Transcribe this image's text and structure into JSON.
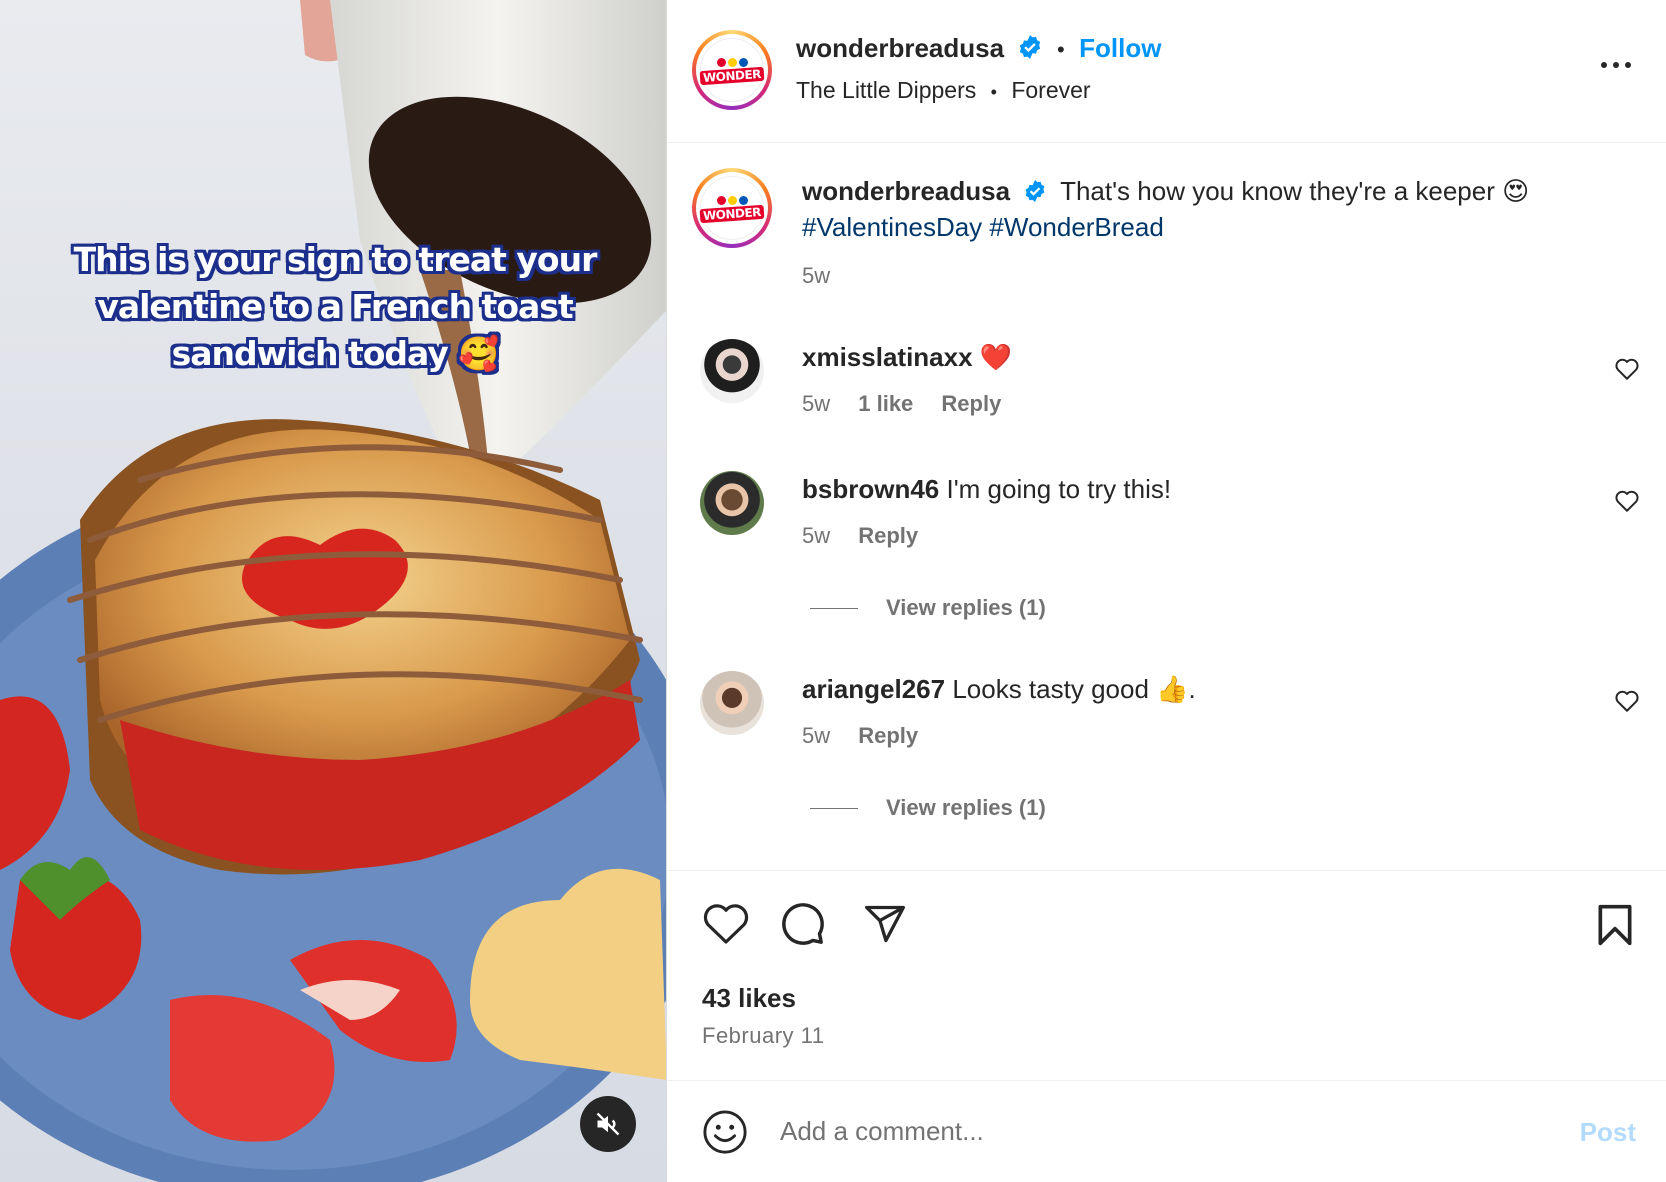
{
  "media": {
    "overlay_text": "This is your sign to treat your valentine to a French toast sandwich today 🥰"
  },
  "post": {
    "author": "wonderbreadusa",
    "follow_label": "Follow",
    "audio_track": "The Little Dippers",
    "audio_song": "Forever",
    "avatar_logo_text": "WONDER",
    "caption_text": "That's how you know they're a keeper 😍",
    "caption_hashtags": "#ValentinesDay #WonderBread",
    "caption_age": "5w",
    "likes": "43 likes",
    "date": "February 11"
  },
  "comments": [
    {
      "user": "xmisslatinaxx",
      "text": "❤️",
      "age": "5w",
      "likes": "1 like",
      "reply": "Reply"
    },
    {
      "user": "bsbrown46",
      "text": "I'm going to try this!",
      "age": "5w",
      "reply": "Reply",
      "view_replies": "View replies (1)"
    },
    {
      "user": "ariangel267",
      "text": "Looks tasty good 👍.",
      "age": "5w",
      "reply": "Reply",
      "view_replies": "View replies (1)"
    }
  ],
  "comment_box": {
    "placeholder": "Add a comment...",
    "post_label": "Post"
  },
  "colors": {
    "link_blue": "#0095f6",
    "hashtag": "#00376b",
    "verified": "#0095f6",
    "post_disabled": "#b3dbff"
  },
  "icons": [
    "mute-icon",
    "verified-icon",
    "more-icon",
    "heart-icon",
    "comment-icon",
    "share-icon",
    "bookmark-icon",
    "emoji-icon"
  ]
}
